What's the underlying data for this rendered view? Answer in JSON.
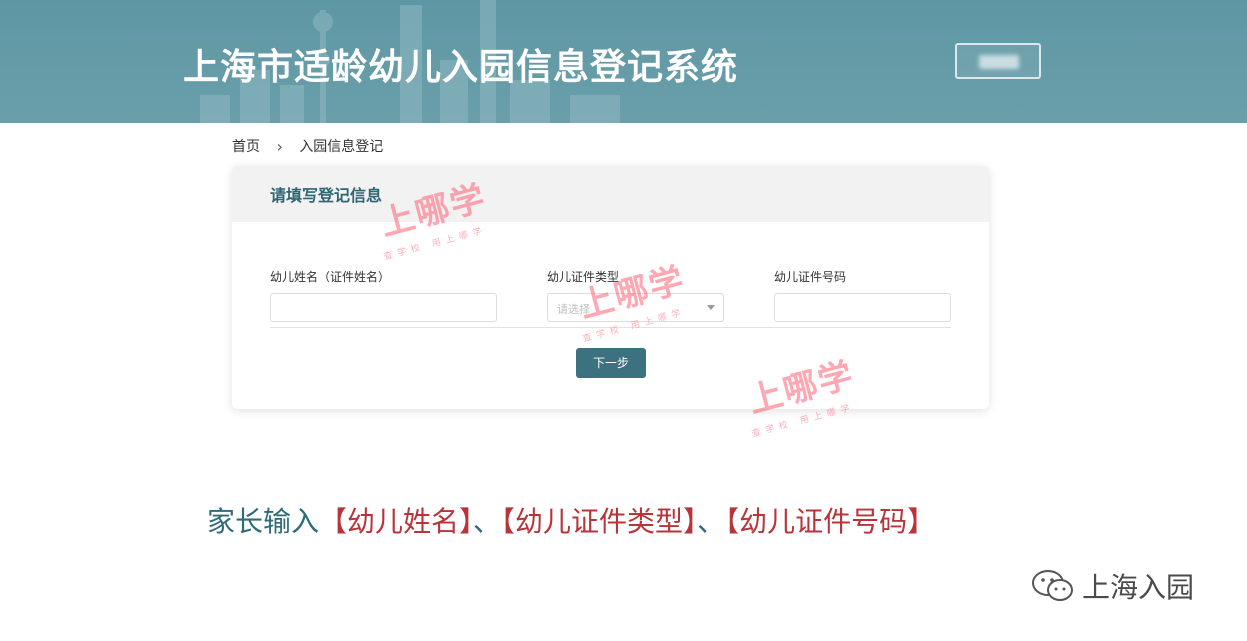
{
  "header": {
    "title": "上海市适龄幼儿入园信息登记系统",
    "login_button": ""
  },
  "breadcrumb": {
    "home": "首页",
    "separator": "›",
    "current": "入园信息登记"
  },
  "form": {
    "heading": "请填写登记信息",
    "fields": [
      {
        "label": "幼儿姓名（证件姓名）",
        "value": ""
      },
      {
        "label": "幼儿证件类型",
        "placeholder": "请选择"
      },
      {
        "label": "幼儿证件号码",
        "value": ""
      }
    ],
    "next_button": "下一步"
  },
  "watermarks": [
    {
      "text": "上哪学",
      "sub": "查学校 用上哪学"
    },
    {
      "text": "上哪学",
      "sub": "查学校 用上哪学"
    },
    {
      "text": "上哪学",
      "sub": "查学校 用上哪学"
    }
  ],
  "caption": {
    "prefix": "家长输入",
    "item1": "【幼儿姓名】",
    "sep1": "、",
    "item2": "【幼儿证件类型】",
    "sep2": "、",
    "item3": "【幼儿证件号码】"
  },
  "footer": {
    "brand": "上海入园",
    "icon": "wechat-icon"
  },
  "colors": {
    "header_bg": "#6a9faa",
    "accent": "#3c7180",
    "caption_highlight": "#b8343b",
    "watermark": "#ff6d7f"
  }
}
